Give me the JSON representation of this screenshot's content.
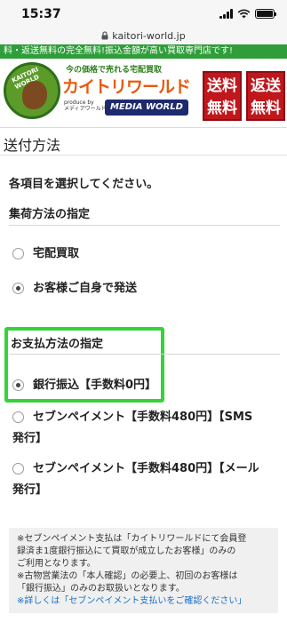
{
  "status_bar": {
    "time": "15:37"
  },
  "browser": {
    "url": "kaitori-world.jp"
  },
  "banner": {
    "text": "料・返送無料の完全無料!振込金額が高い買取専門店です!"
  },
  "header": {
    "tagline": "今の価格で売れる宅配買取",
    "brand": "カイトリワールド",
    "produced_by": "produce by",
    "produced_by_ja": "メディアワールド",
    "media_logo": "MEDIA WORLD",
    "badge1": [
      "送料",
      "無料"
    ],
    "badge2": [
      "返送",
      "無料"
    ]
  },
  "page": {
    "title": "送付方法",
    "instruction": "各項目を選択してください。"
  },
  "collection": {
    "heading": "集荷方法の指定",
    "options": [
      {
        "label": "宅配買取",
        "checked": false
      },
      {
        "label": "お客様ご自身で発送",
        "checked": true
      }
    ]
  },
  "payment": {
    "heading": "お支払方法の指定",
    "options": [
      {
        "label": "銀行振込【手数料0円】",
        "checked": true
      },
      {
        "label_line1": "セブンペイメント【手数料480円】【SMS",
        "label_line2": "発行】",
        "checked": false
      },
      {
        "label_line1": "セブンペイメント【手数料480円】【メール",
        "label_line2": "発行】",
        "checked": false
      }
    ]
  },
  "notice": {
    "line1": "※セブンペイメント支払は「カイトリワールドにて会員登",
    "line2": "録済ま1度銀行振込にて買取が成立したお客様」のみの",
    "line3": "ご利用となります。",
    "line4": "※古物営業法の「本人確認」の必要上、初回のお客様は",
    "line5": "「銀行振込」のみのお取扱いとなります。",
    "link": "※詳しくは「セブンペイメント支払いをご確認ください」"
  },
  "colors": {
    "banner_green": "#2f9e3a",
    "brand_orange": "#e85a0c",
    "badge_red": "#c0171d",
    "highlight_green": "#37d23a",
    "link_blue": "#1a6fc7"
  },
  "icons": [
    "signal-icon",
    "wifi-icon",
    "battery-icon",
    "lock-icon"
  ]
}
